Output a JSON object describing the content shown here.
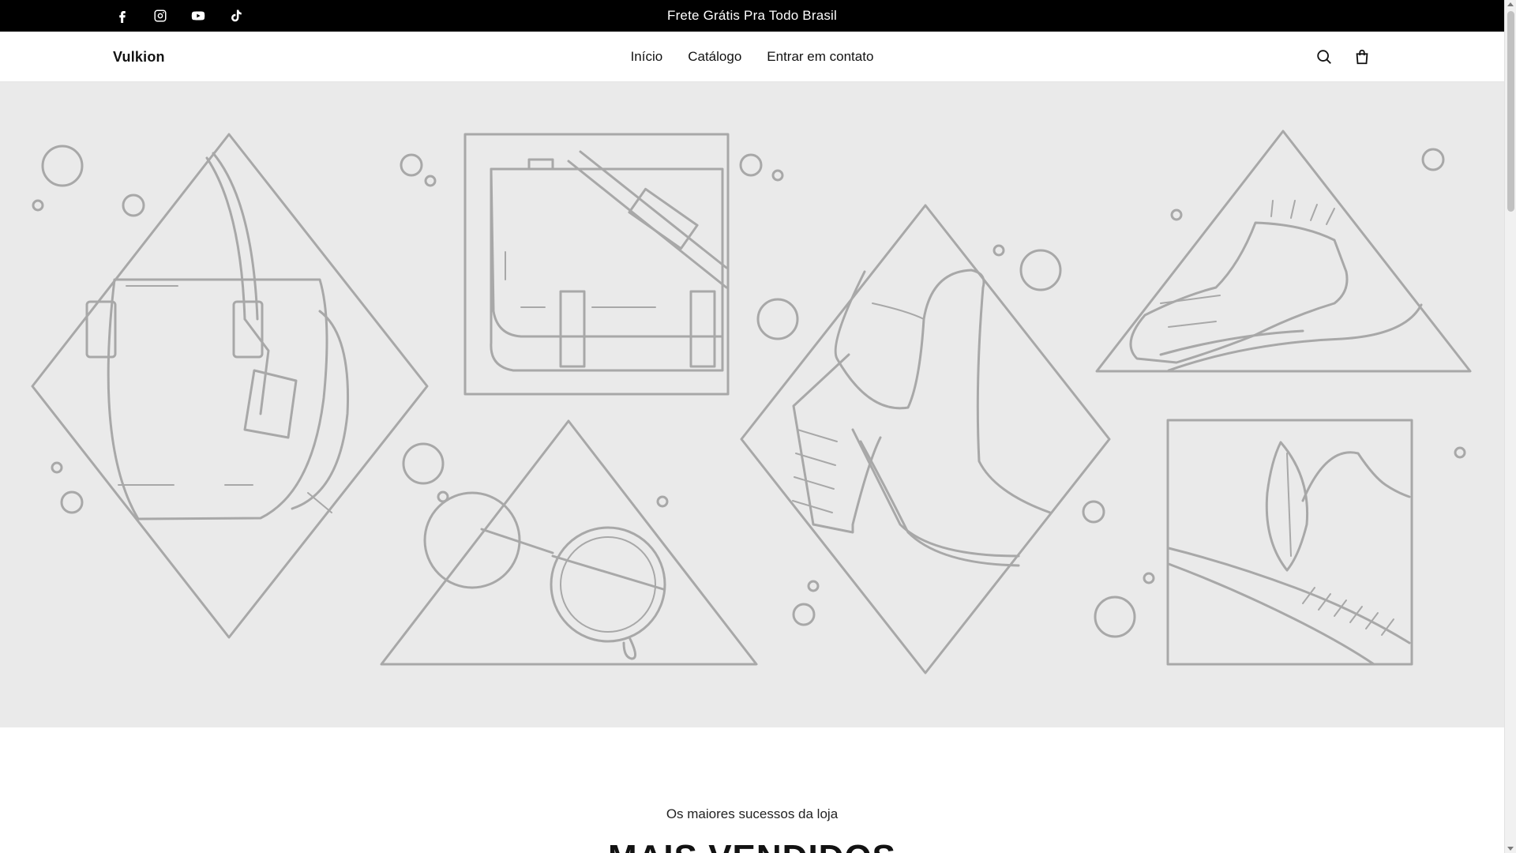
{
  "announcement": {
    "text": "Frete Grátis Pra Todo Brasil",
    "social": [
      {
        "icon": "facebook-icon"
      },
      {
        "icon": "instagram-icon"
      },
      {
        "icon": "youtube-icon"
      },
      {
        "icon": "tiktok-icon"
      }
    ]
  },
  "header": {
    "logo": "Vulkion",
    "nav": [
      "Início",
      "Catálogo",
      "Entrar em contato"
    ],
    "icons": [
      "search-icon",
      "cart-icon"
    ]
  },
  "section": {
    "subtitle": "Os maiores sucessos da loja",
    "title": "MAIS VENDIDOS"
  },
  "colors": {
    "announcement_bg": "#000000",
    "hero_bg": "#eaeaea",
    "illustration_stroke": "#a8a8a8"
  }
}
